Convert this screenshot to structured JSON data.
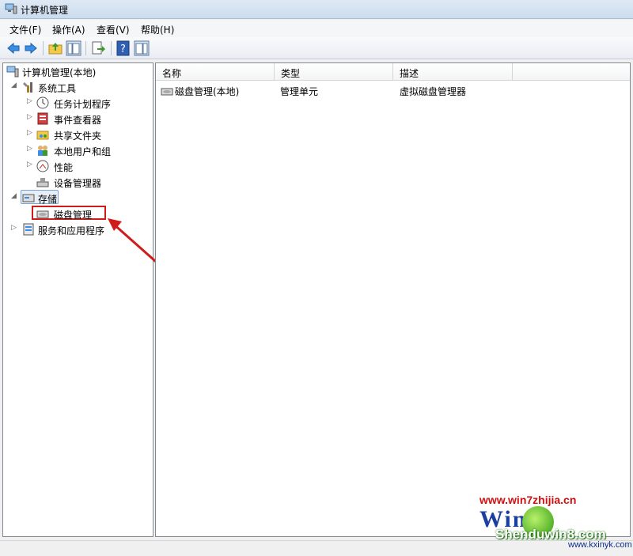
{
  "window": {
    "title": "计算机管理"
  },
  "menu": [
    {
      "label": "文件(F)"
    },
    {
      "label": "操作(A)"
    },
    {
      "label": "查看(V)"
    },
    {
      "label": "帮助(H)"
    }
  ],
  "toolbar": {
    "buttons": [
      "back-icon",
      "forward-icon",
      "up-folder-icon",
      "show-hide-tree-icon",
      "export-list-icon",
      "help-icon",
      "show-hide-action-pane-icon"
    ]
  },
  "tree": {
    "root": "计算机管理(本地)",
    "items": [
      {
        "label": "系统工具",
        "level": 1,
        "expanded": true,
        "icon": "tools-icon"
      },
      {
        "label": "任务计划程序",
        "level": 2,
        "icon": "clock-icon"
      },
      {
        "label": "事件查看器",
        "level": 2,
        "icon": "event-viewer-icon"
      },
      {
        "label": "共享文件夹",
        "level": 2,
        "icon": "shared-folder-icon"
      },
      {
        "label": "本地用户和组",
        "level": 2,
        "icon": "users-icon"
      },
      {
        "label": "性能",
        "level": 2,
        "icon": "performance-icon"
      },
      {
        "label": "设备管理器",
        "level": 2,
        "icon": "device-manager-icon"
      },
      {
        "label": "存储",
        "level": 1,
        "expanded": true,
        "icon": "storage-icon"
      },
      {
        "label": "磁盘管理",
        "level": 2,
        "icon": "disk-icon"
      },
      {
        "label": "服务和应用程序",
        "level": 1,
        "icon": "services-icon"
      }
    ]
  },
  "list": {
    "columns": [
      "名称",
      "类型",
      "描述"
    ],
    "rows": [
      {
        "name": "磁盘管理(本地)",
        "type": "管理单元",
        "description": "虚拟磁盘管理器"
      }
    ]
  },
  "watermark": {
    "url1": "www.win7zhijia.cn",
    "logo": "Win7",
    "site": "Shenduwin8.com",
    "url2": "www.kxinyk.com"
  },
  "colors": {
    "highlight": "#d11a1a",
    "selection": "#7da2ce"
  }
}
